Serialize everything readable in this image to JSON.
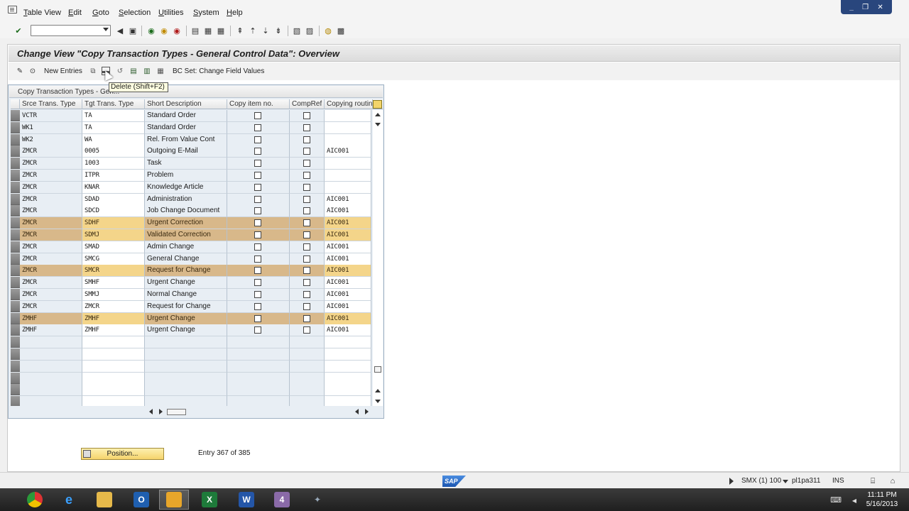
{
  "menu": [
    "Table View",
    "Edit",
    "Goto",
    "Selection",
    "Utilities",
    "System",
    "Help"
  ],
  "window_controls": [
    "_",
    "❐",
    "✕"
  ],
  "command_field": {
    "value": ""
  },
  "title": "Change View \"Copy Transaction Types - General Control Data\": Overview",
  "app_toolbar": {
    "new_entries": "New Entries",
    "bc_set": "BC Set: Change Field Values"
  },
  "tooltip": "Delete   (Shift+F2)",
  "table": {
    "title": "Copy Transaction Types - Gen...",
    "headers": [
      "Srce Trans. Type",
      "Tgt Trans. Type",
      "Short Description",
      "Copy item no.",
      "CompRef",
      "Copying routin"
    ],
    "rows": [
      {
        "src": "VCTR",
        "tgt": "TA",
        "desc": "Standard Order",
        "copy": false,
        "comp": false,
        "routine": "",
        "hl": false
      },
      {
        "src": "WK1",
        "tgt": "TA",
        "desc": "Standard Order",
        "copy": false,
        "comp": false,
        "routine": "",
        "hl": false
      },
      {
        "src": "WK2",
        "tgt": "WA",
        "desc": "Rel. From Value Cont",
        "copy": false,
        "comp": false,
        "routine": "",
        "hl": false
      },
      {
        "src": "ZMCR",
        "tgt": "0005",
        "desc": "Outgoing E-Mail",
        "copy": false,
        "comp": false,
        "routine": "AIC001",
        "hl": false
      },
      {
        "src": "ZMCR",
        "tgt": "1003",
        "desc": "Task",
        "copy": false,
        "comp": false,
        "routine": "",
        "hl": false
      },
      {
        "src": "ZMCR",
        "tgt": "ITPR",
        "desc": "Problem",
        "copy": false,
        "comp": false,
        "routine": "",
        "hl": false
      },
      {
        "src": "ZMCR",
        "tgt": "KNAR",
        "desc": "Knowledge Article",
        "copy": false,
        "comp": false,
        "routine": "",
        "hl": false
      },
      {
        "src": "ZMCR",
        "tgt": "SDAD",
        "desc": "Administration",
        "copy": false,
        "comp": false,
        "routine": "AIC001",
        "hl": false
      },
      {
        "src": "ZMCR",
        "tgt": "SDCD",
        "desc": "Job Change Document",
        "copy": false,
        "comp": false,
        "routine": "AIC001",
        "hl": false
      },
      {
        "src": "ZMCR",
        "tgt": "SDHF",
        "desc": "Urgent Correction",
        "copy": false,
        "comp": false,
        "routine": "AIC001",
        "hl": true
      },
      {
        "src": "ZMCR",
        "tgt": "SDMJ",
        "desc": "Validated Correction",
        "copy": false,
        "comp": false,
        "routine": "AIC001",
        "hl": true
      },
      {
        "src": "ZMCR",
        "tgt": "SMAD",
        "desc": "Admin Change",
        "copy": false,
        "comp": false,
        "routine": "AIC001",
        "hl": false
      },
      {
        "src": "ZMCR",
        "tgt": "SMCG",
        "desc": "General Change",
        "copy": false,
        "comp": false,
        "routine": "AIC001",
        "hl": false
      },
      {
        "src": "ZMCR",
        "tgt": "SMCR",
        "desc": "Request for Change",
        "copy": false,
        "comp": false,
        "routine": "AIC001",
        "hl": true
      },
      {
        "src": "ZMCR",
        "tgt": "SMHF",
        "desc": "Urgent Change",
        "copy": false,
        "comp": false,
        "routine": "AIC001",
        "hl": false
      },
      {
        "src": "ZMCR",
        "tgt": "SMMJ",
        "desc": "Normal Change",
        "copy": false,
        "comp": false,
        "routine": "AIC001",
        "hl": false
      },
      {
        "src": "ZMCR",
        "tgt": "ZMCR",
        "desc": "Request for Change",
        "copy": false,
        "comp": false,
        "routine": "AIC001",
        "hl": false
      },
      {
        "src": "ZMHF",
        "tgt": "ZMHF",
        "desc": "Urgent Change",
        "copy": false,
        "comp": false,
        "routine": "AIC001",
        "hl": true
      },
      {
        "src": "ZMHF",
        "tgt": "ZMHF",
        "desc": "Urgent Change",
        "copy": false,
        "comp": false,
        "routine": "AIC001",
        "hl": false
      }
    ],
    "empty_rows": 6
  },
  "position_button": "Position...",
  "entry_info": "Entry 367 of 385",
  "status": {
    "system": "SMX (1) 100",
    "server": "pl1pa311",
    "mode": "INS"
  },
  "clock": {
    "time": "11:11 PM",
    "date": "5/16/2013"
  },
  "colors": {
    "highlight_row": "#d8b88a",
    "highlight_cell": "#f4d58a",
    "table_bg": "#e8eef4",
    "winbtn": "#29467d"
  }
}
